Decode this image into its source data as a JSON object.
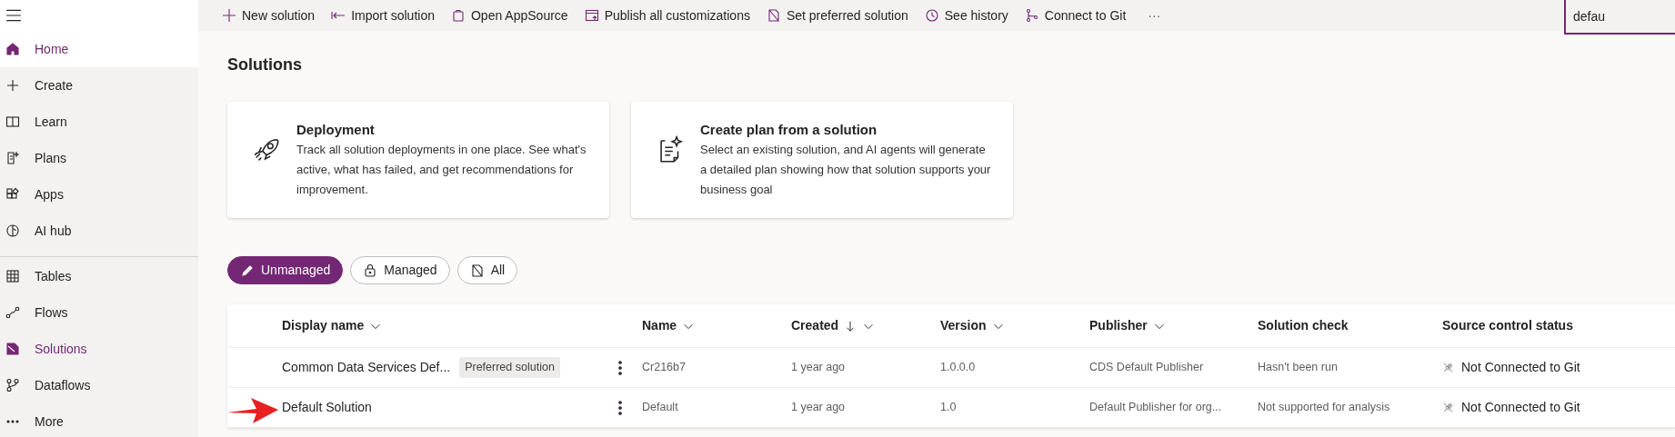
{
  "sidebar": {
    "items": [
      {
        "label": "Home",
        "selected": true,
        "hovered": true
      },
      {
        "label": "Create",
        "selected": false,
        "hovered": false
      },
      {
        "label": "Learn",
        "selected": false,
        "hovered": false
      },
      {
        "label": "Plans",
        "selected": false,
        "hovered": false
      },
      {
        "label": "Apps",
        "selected": false,
        "hovered": false
      },
      {
        "label": "AI hub",
        "selected": false,
        "hovered": false
      },
      {
        "label": "Tables",
        "selected": false,
        "hovered": false
      },
      {
        "label": "Flows",
        "selected": false,
        "hovered": false
      },
      {
        "label": "Solutions",
        "selected": true,
        "hovered": false
      },
      {
        "label": "Dataflows",
        "selected": false,
        "hovered": false
      },
      {
        "label": "More",
        "selected": false,
        "hovered": false
      }
    ]
  },
  "toolbar": {
    "buttons": [
      "New solution",
      "Import solution",
      "Open AppSource",
      "Publish all customizations",
      "Set preferred solution",
      "See history",
      "Connect to Git"
    ],
    "more": "···"
  },
  "search": {
    "value": "defau"
  },
  "page_title": "Solutions",
  "cards": [
    {
      "title": "Deployment",
      "text": "Track all solution deployments in one place. See what's active, what has failed, and get recommendations for improvement."
    },
    {
      "title": "Create plan from a solution",
      "text": "Select an existing solution, and AI agents will generate a detailed plan showing how that solution supports your business goal"
    }
  ],
  "filters": [
    {
      "label": "Unmanaged",
      "selected": true
    },
    {
      "label": "Managed",
      "selected": false
    },
    {
      "label": "All",
      "selected": false
    }
  ],
  "table": {
    "columns": [
      {
        "label": "Display name",
        "sortable": true,
        "sorted": false
      },
      {
        "label": "Name",
        "sortable": true,
        "sorted": false
      },
      {
        "label": "Created",
        "sortable": true,
        "sorted": true
      },
      {
        "label": "Version",
        "sortable": true,
        "sorted": false
      },
      {
        "label": "Publisher",
        "sortable": true,
        "sorted": false
      },
      {
        "label": "Solution check",
        "sortable": false,
        "sorted": false
      },
      {
        "label": "Source control status",
        "sortable": false,
        "sorted": false
      }
    ],
    "rows": [
      {
        "display_name": "Common Data Services Def...",
        "badge": "Preferred solution",
        "name": "Cr216b7",
        "created": "1 year ago",
        "version": "1.0.0.0",
        "publisher": "CDS Default Publisher",
        "solution_check": "Hasn't been run",
        "source_control": "Not Connected to Git",
        "marked": false
      },
      {
        "display_name": "Default Solution",
        "name": "Default",
        "created": "1 year ago",
        "version": "1.0",
        "publisher": "Default Publisher for org...",
        "solution_check": "Not supported for analysis",
        "source_control": "Not Connected to Git",
        "marked": true
      }
    ]
  }
}
